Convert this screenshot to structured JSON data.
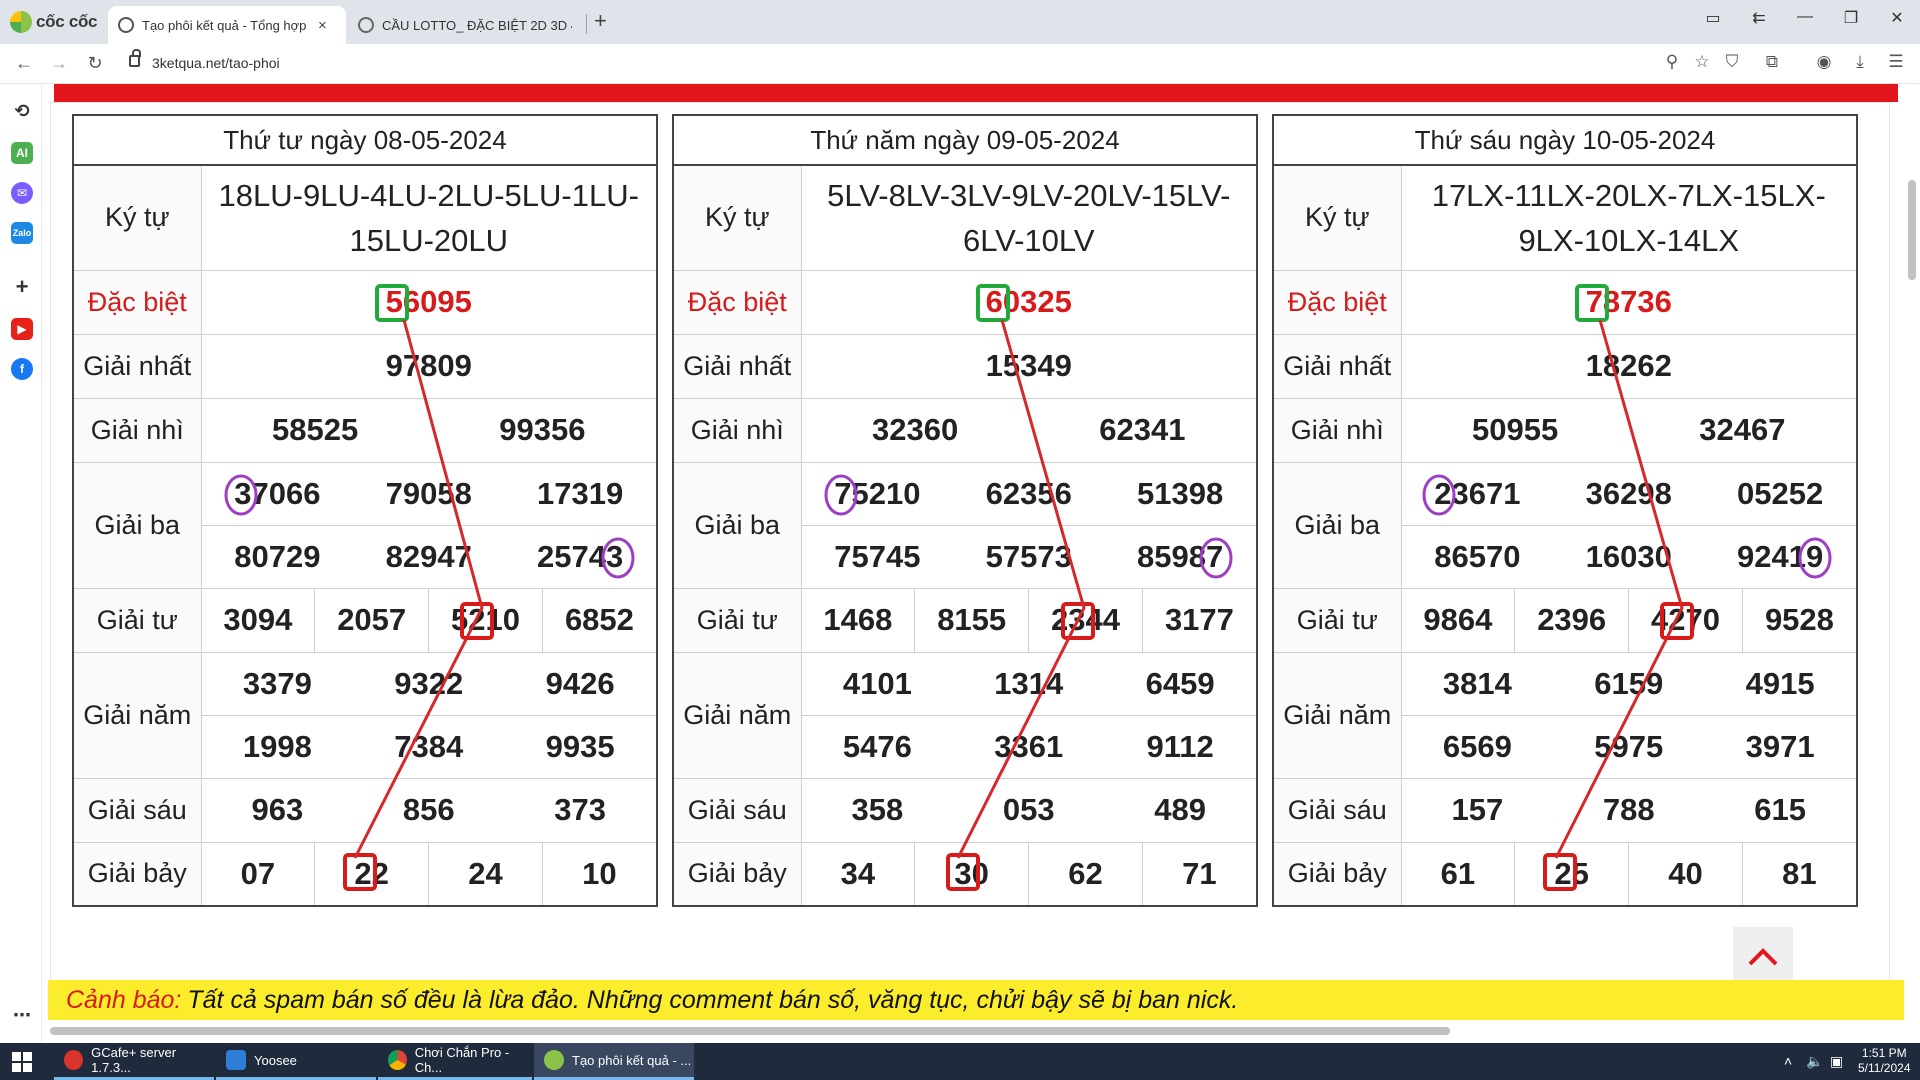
{
  "browser": {
    "brand": "cốc cốc",
    "tabs": [
      {
        "title": "Tạo phôi kết quả - Tổng hợp",
        "close": "×"
      },
      {
        "title": "CẦU LOTTO_ ĐẶC BIỆT 2D 3D 4D"
      }
    ],
    "new_tab": "+",
    "url": "3ketqua.net/tao-phoi"
  },
  "colors": {
    "highlight_green": "#1faa3a",
    "highlight_red": "#d71a1a",
    "circle_purple": "#9c3fc4",
    "line_red": "#d62828"
  },
  "labels": {
    "ky_tu": "Ký tự",
    "dac_biet": "Đặc biệt",
    "giai_nhat": "Giải nhất",
    "giai_nhi": "Giải nhì",
    "giai_ba": "Giải ba",
    "giai_tu": "Giải tư",
    "giai_nam": "Giải năm",
    "giai_sau": "Giải sáu",
    "giai_bay": "Giải bảy"
  },
  "results": [
    {
      "date": "Thứ tư ngày 08-05-2024",
      "ky_tu": "18LU-9LU-4LU-2LU-5LU-1LU-15LU-20LU",
      "dac_biet": "56095",
      "nhat": "97809",
      "nhi": [
        "58525",
        "99356"
      ],
      "ba": [
        "37066",
        "79058",
        "17319",
        "80729",
        "82947",
        "25743"
      ],
      "tu": [
        "3094",
        "2057",
        "5210",
        "6852"
      ],
      "nam": [
        "3379",
        "9322",
        "9426",
        "1998",
        "7384",
        "9935"
      ],
      "sau": [
        "963",
        "856",
        "373"
      ],
      "bay": [
        "07",
        "22",
        "24",
        "10"
      ]
    },
    {
      "date": "Thứ năm ngày 09-05-2024",
      "ky_tu": "5LV-8LV-3LV-9LV-20LV-15LV-6LV-10LV",
      "dac_biet": "60325",
      "nhat": "15349",
      "nhi": [
        "32360",
        "62341"
      ],
      "ba": [
        "75210",
        "62356",
        "51398",
        "75745",
        "57573",
        "85987"
      ],
      "tu": [
        "1468",
        "8155",
        "2344",
        "3177"
      ],
      "nam": [
        "4101",
        "1314",
        "6459",
        "5476",
        "3361",
        "9112"
      ],
      "sau": [
        "358",
        "053",
        "489"
      ],
      "bay": [
        "34",
        "30",
        "62",
        "71"
      ]
    },
    {
      "date": "Thứ sáu ngày 10-05-2024",
      "ky_tu": "17LX-11LX-20LX-7LX-15LX-9LX-10LX-14LX",
      "dac_biet": "78736",
      "nhat": "18262",
      "nhi": [
        "50955",
        "32467"
      ],
      "ba": [
        "23671",
        "36298",
        "05252",
        "86570",
        "16030",
        "92419"
      ],
      "tu": [
        "9864",
        "2396",
        "4270",
        "9528"
      ],
      "nam": [
        "3814",
        "6159",
        "4915",
        "6569",
        "5975",
        "3971"
      ],
      "sau": [
        "157",
        "788",
        "615"
      ],
      "bay": [
        "61",
        "25",
        "40",
        "81"
      ]
    }
  ],
  "warning": {
    "label": "Cảnh báo:",
    "text": "Tất cả spam bán số đều là lừa đảo. Những comment bán số, văng tục, chửi bậy sẽ bị ban nick."
  },
  "taskbar": {
    "items": [
      "GCafe+ server 1.7.3...",
      "Yoosee",
      "Chơi Chắn Pro - Ch...",
      "Tạo phôi kết quả - ..."
    ],
    "time": "1:51 PM",
    "date": "5/11/2024"
  }
}
